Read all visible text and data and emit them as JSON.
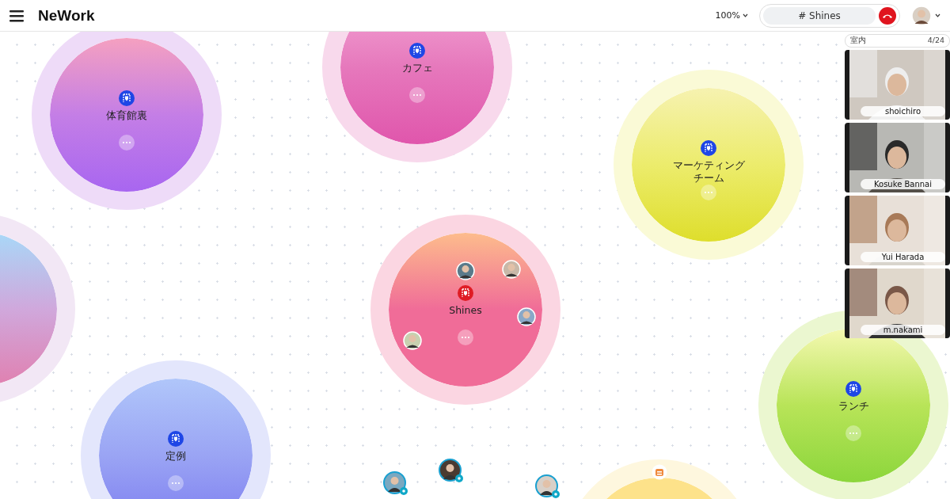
{
  "app": {
    "title": "NeWork"
  },
  "zoom": {
    "label": "100%"
  },
  "call": {
    "channel": "# Shines"
  },
  "room_panel": {
    "label": "室内",
    "count": "4/24",
    "participants": [
      {
        "name": "shoichiro"
      },
      {
        "name": "Kosuke Bannai"
      },
      {
        "name": "Yui Harada"
      },
      {
        "name": "m.nakami"
      }
    ]
  },
  "rooms": [
    {
      "name": "体育館裏",
      "color": "#c47ee6",
      "selected": false
    },
    {
      "name": "カフェ",
      "color": "#e678bc",
      "selected": false
    },
    {
      "name": "マーケティングチーム",
      "color": "#ecec6c",
      "selected": false
    },
    {
      "color": "#d0a8dc"
    },
    {
      "name": "Shines",
      "color": "#f06c98",
      "selected": true
    },
    {
      "name": "定例",
      "color": "#9aa4f4",
      "selected": false
    },
    {
      "name": "ランチ",
      "color": "#b8e458",
      "selected": false
    },
    {
      "color": "#fde28a",
      "members": [
        {
          "kind": "mark"
        }
      ]
    }
  ]
}
